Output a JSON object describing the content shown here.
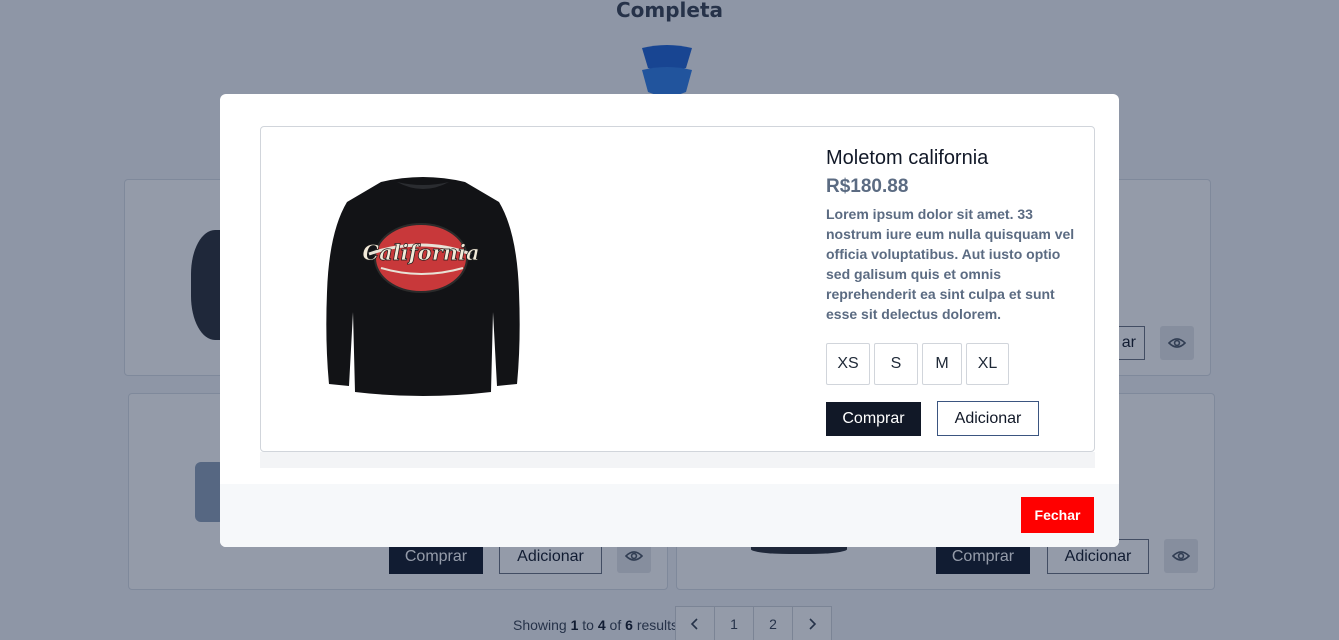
{
  "background": {
    "title": "Completa",
    "cards": [
      {
        "buy_label": "Comprar",
        "add_label": "Adicionar"
      },
      {
        "buy_label": "Comprar",
        "add_label": "Adicionar"
      },
      {
        "add_label_partial": "ar"
      }
    ],
    "pagination": {
      "prefix": "Showing",
      "from": "1",
      "to_word": "to",
      "to": "4",
      "of_word": "of",
      "total": "6",
      "suffix": "results",
      "pages": [
        "1",
        "2"
      ],
      "prev_icon": "chevron-left-icon",
      "next_icon": "chevron-right-icon"
    }
  },
  "modal": {
    "product": {
      "name": "Moletom california",
      "price": "R$180.88",
      "description": "Lorem ipsum dolor sit amet. 33 nostrum iure eum nulla quisquam vel officia voluptatibus. Aut iusto optio sed galisum quis et omnis reprehenderit ea sint culpa et sunt esse sit delectus dolorem.",
      "image_text": "California",
      "sizes": [
        "XS",
        "S",
        "M",
        "XL"
      ],
      "buy_label": "Comprar",
      "add_label": "Adicionar"
    },
    "close_label": "Fechar"
  },
  "colors": {
    "close_button": "#ff0000",
    "buy_button": "#111827",
    "price_text": "#5b6b82"
  }
}
